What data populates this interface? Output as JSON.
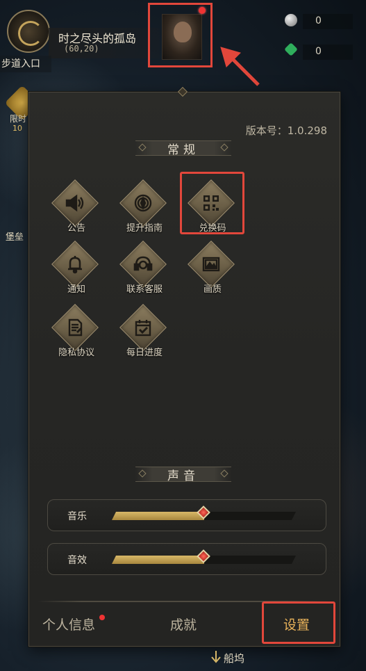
{
  "hud": {
    "place_name": "时之尽头的孤岛",
    "coordinates": "(60,20)",
    "area_label": "步道入口",
    "resources": [
      {
        "icon": "silver-coin-icon",
        "value": "0"
      },
      {
        "icon": "green-gem-icon",
        "value": "0"
      }
    ]
  },
  "side": {
    "event_label": "限时",
    "event_value": "10",
    "fort_label": "堡垒"
  },
  "settings_panel": {
    "version": "版本号：1.0.298",
    "section_general": "常规",
    "section_sound": "声音",
    "items": [
      {
        "label": "公告",
        "icon": "speaker-icon"
      },
      {
        "label": "提升指南",
        "icon": "compass-icon"
      },
      {
        "label": "兑换码",
        "icon": "qr-code-icon"
      },
      {
        "label": "通知",
        "icon": "bell-icon"
      },
      {
        "label": "联系客服",
        "icon": "headset-icon"
      },
      {
        "label": "画质",
        "icon": "image-icon"
      },
      {
        "label": "隐私协议",
        "icon": "document-icon"
      },
      {
        "label": "每日进度",
        "icon": "calendar-check-icon"
      }
    ],
    "sound": {
      "music_label": "音乐",
      "music_level": 0.5,
      "sfx_label": "音效",
      "sfx_level": 0.5
    }
  },
  "tabs": {
    "profile": "个人信息",
    "achievements": "成就",
    "settings": "设置",
    "active": "settings"
  },
  "bottom": {
    "dock_label": "船坞"
  },
  "colors": {
    "annotation_red": "#e2473b",
    "active_tab": "#e8b25a",
    "slider_fill": "#c9a657"
  }
}
